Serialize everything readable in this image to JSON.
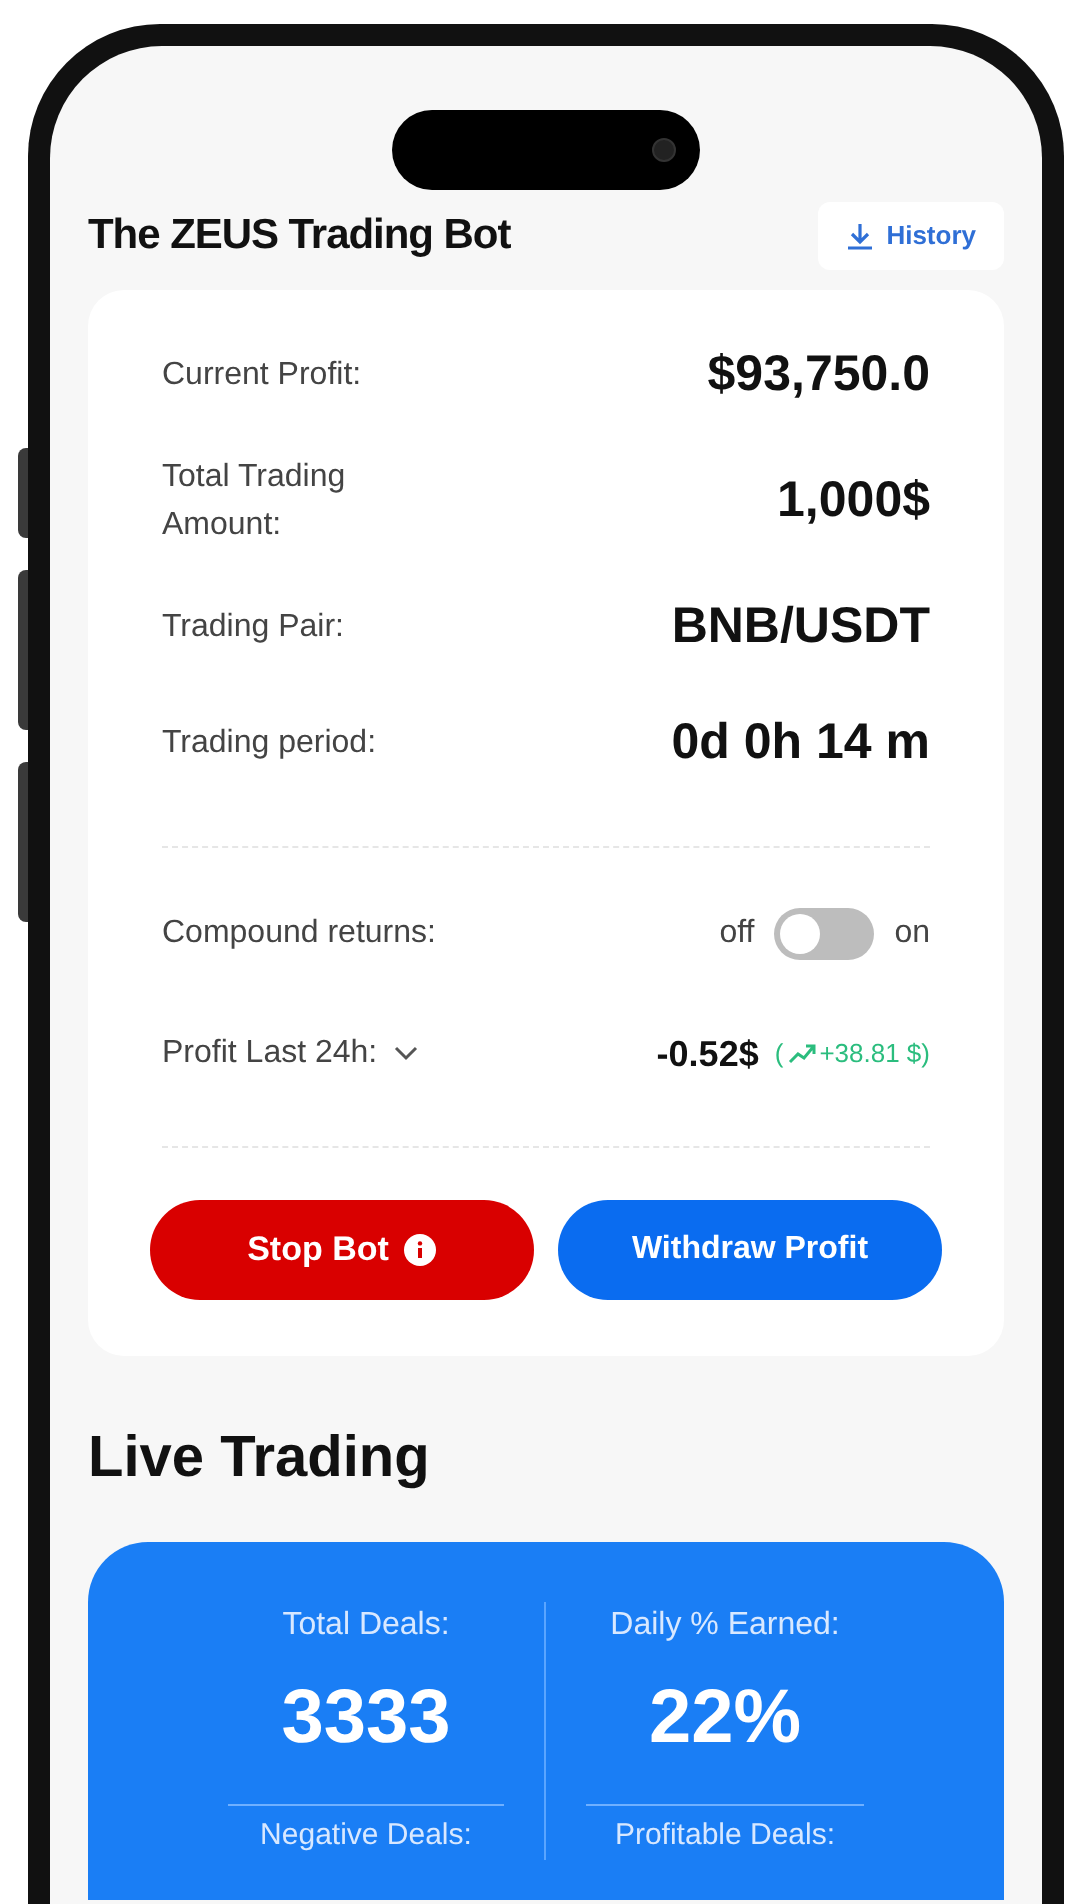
{
  "header": {
    "title": "The ZEUS Trading Bot",
    "history_button": "History"
  },
  "summary": [
    {
      "label": "Current Profit:",
      "value": "$93,750.0"
    },
    {
      "label": "Total Trading Amount:",
      "value": "1,000$"
    },
    {
      "label": "Trading Pair:",
      "value": "BNB/USDT"
    },
    {
      "label": "Trading period:",
      "value": "0d 0h 14 m"
    }
  ],
  "compound": {
    "label": "Compound returns:",
    "off_label": "off",
    "on_label": "on",
    "on": false
  },
  "profit_24h": {
    "label": "Profit Last 24h:",
    "value": "-0.52$",
    "change_open": "(",
    "change": "+38.81 $",
    "change_close": ")"
  },
  "buttons": {
    "stop": "Stop Bot",
    "withdraw": "Withdraw Profit"
  },
  "live_trading": {
    "title": "Live Trading",
    "stats": [
      {
        "label": "Total Deals:",
        "value": "3333"
      },
      {
        "label": "Daily % Earned:",
        "value": "22%"
      }
    ],
    "next_labels": [
      "Negative Deals:",
      "Profitable Deals:"
    ]
  }
}
